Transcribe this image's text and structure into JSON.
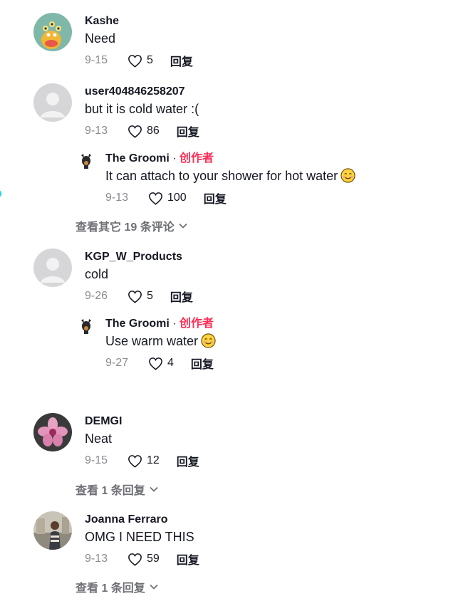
{
  "colors": {
    "creator": "#fe2c55",
    "muted": "#8a8b91",
    "text": "#161823"
  },
  "reply_label": "回复",
  "comments": [
    {
      "username": "Kashe",
      "text": "Need",
      "date": "9-15",
      "likes": "5",
      "avatar": "cartoon-monster"
    },
    {
      "username": "user404846258207",
      "text": "but it is cold water :(",
      "date": "9-13",
      "likes": "86",
      "avatar": "default",
      "reply": {
        "username": "The Groomi",
        "badge": "创作者",
        "text": "It can attach to your shower for hot water",
        "emoji": "smiling-face",
        "date": "9-13",
        "likes": "100"
      },
      "more": "查看其它 19 条评论"
    },
    {
      "username": "KGP_W_Products",
      "text": "cold",
      "date": "9-26",
      "likes": "5",
      "avatar": "default",
      "reply": {
        "username": "The Groomi",
        "badge": "创作者",
        "text": "Use warm water",
        "emoji": "smiling-face",
        "date": "9-27",
        "likes": "4"
      }
    },
    {
      "username": "DEMGI",
      "text": "Neat",
      "date": "9-15",
      "likes": "12",
      "avatar": "pink-flower",
      "more": "查看 1 条回复"
    },
    {
      "username": "Joanna Ferraro",
      "text": "OMG I NEED THIS",
      "date": "9-13",
      "likes": "59",
      "avatar": "photo-person",
      "more": "查看 1 条回复"
    }
  ]
}
